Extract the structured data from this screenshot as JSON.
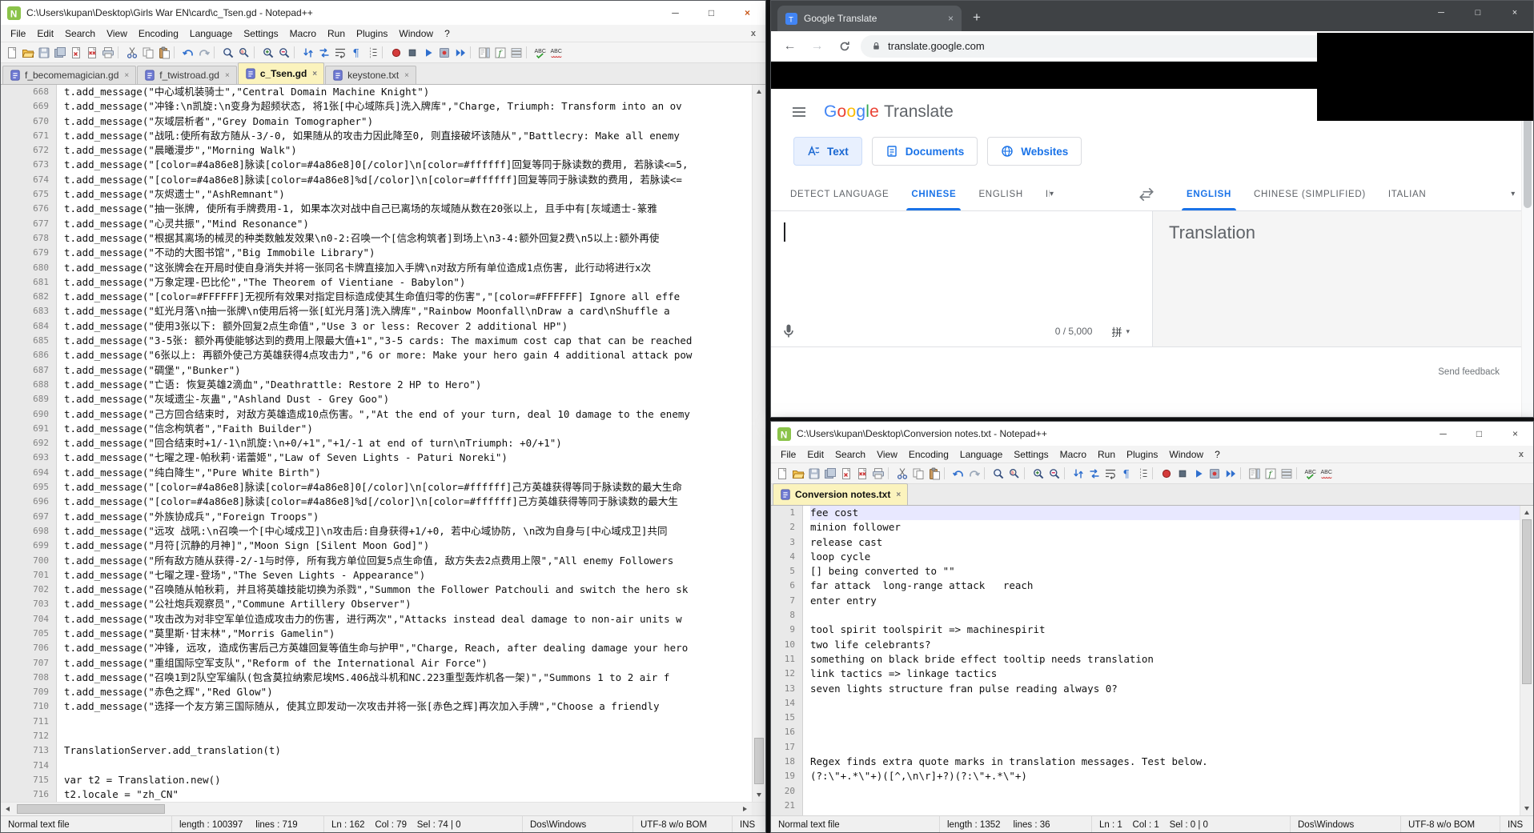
{
  "notepad_shared": {
    "menus": [
      "File",
      "Edit",
      "Search",
      "View",
      "Encoding",
      "Language",
      "Settings",
      "Macro",
      "Run",
      "Plugins",
      "Window",
      "?"
    ],
    "toolbar_icons": [
      "new-file",
      "open",
      "save",
      "save-all",
      "close",
      "close-all",
      "print",
      "sep",
      "cut",
      "copy",
      "paste",
      "sep",
      "undo",
      "redo",
      "sep",
      "find",
      "replace",
      "sep",
      "zoom-in",
      "zoom-out",
      "sep",
      "sync-v",
      "sync-h",
      "word-wrap",
      "show-all-chars",
      "indent-guide",
      "sep",
      "record-macro",
      "stop-macro",
      "play-macro",
      "save-macro",
      "run-macro",
      "sep",
      "doc-map",
      "function-list",
      "doc-list",
      "sep",
      "spell-check",
      "auto-spell"
    ]
  },
  "left_editor_window": {
    "title": "C:\\Users\\kupan\\Desktop\\Girls War EN\\card\\c_Tsen.gd - Notepad++",
    "tabs": [
      {
        "label": "f_becomemagician.gd",
        "active": false
      },
      {
        "label": "f_twistroad.gd",
        "active": false
      },
      {
        "label": "c_Tsen.gd",
        "active": true
      },
      {
        "label": "keystone.txt",
        "active": false
      }
    ],
    "first_line": 668,
    "current_line": 0,
    "lines": [
      "t.add_message(\"中心域机装骑士\",\"Central Domain Machine Knight\")",
      "t.add_message(\"冲锋:\\n凯旋:\\n变身为超频状态, 将1张[中心域陈兵]洗入牌库\",\"Charge, Triumph: Transform into an ov",
      "t.add_message(\"灰域层析者\",\"Grey Domain Tomographer\")",
      "t.add_message(\"战吼:使所有敌方随从-3/-0, 如果随从的攻击力因此降至0, 则直接破坏该随从\",\"Battlecry: Make all enemy",
      "t.add_message(\"晨曦漫步\",\"Morning Walk\")",
      "t.add_message(\"[color=#4a86e8]脉读[color=#4a86e8]0[/color]\\n[color=#ffffff]回复等同于脉读数的费用, 若脉读<=5,",
      "t.add_message(\"[color=#4a86e8]脉读[color=#4a86e8]%d[/color]\\n[color=#ffffff]回复等同于脉读数的费用, 若脉读<=",
      "t.add_message(\"灰烬遗士\",\"AshRemnant\")",
      "t.add_message(\"抽一张牌, 使所有手牌费用-1, 如果本次对战中自己已离场的灰域随从数在20张以上, 且手中有[灰域遗士-篆雅",
      "t.add_message(\"心灵共振\",\"Mind Resonance\")",
      "t.add_message(\"根据其离场的械灵的种类数触发效果\\n0-2:召唤一个[信念枸筑者]到场上\\n3-4:额外回复2费\\n5以上:额外再使",
      "t.add_message(\"不动的大图书馆\",\"Big Immobile Library\")",
      "t.add_message(\"这张牌会在开局时使自身消失并将一张同名卡牌直接加入手牌\\n对敌方所有单位造成1点伤害, 此行动将进行x次",
      "t.add_message(\"万象定理-巴比伦\",\"The Theorem of Vientiane - Babylon\")",
      "t.add_message(\"[color=#FFFFFF]无视所有效果对指定目标造成使其生命值归零的伤害\",\"[color=#FFFFFF] Ignore all effe",
      "t.add_message(\"虹光月落\\n抽一张牌\\n使用后将一张[虹光月落]洗入牌库\",\"Rainbow Moonfall\\nDraw a card\\nShuffle a",
      "t.add_message(\"使用3张以下: 额外回复2点生命值\",\"Use 3 or less: Recover 2 additional HP\")",
      "t.add_message(\"3-5张: 额外再使能够达到的费用上限最大值+1\",\"3-5 cards: The maximum cost cap that can be reached",
      "t.add_message(\"6张以上: 再额外使己方英雄获得4点攻击力\",\"6 or more: Make your hero gain 4 additional attack pow",
      "t.add_message(\"碉堡\",\"Bunker\")",
      "t.add_message(\"亡语: 恢复英雄2滴血\",\"Deathrattle: Restore 2 HP to Hero\")",
      "t.add_message(\"灰域遗尘-灰蛊\",\"Ashland Dust - Grey Goo\")",
      "t.add_message(\"己方回合结束时, 对敌方英雄造成10点伤害。\",\"At the end of your turn, deal 10 damage to the enemy",
      "t.add_message(\"信念枸筑者\",\"Faith Builder\")",
      "t.add_message(\"回合结束时+1/-1\\n凯旋:\\n+0/+1\",\"+1/-1 at end of turn\\nTriumph: +0/+1\")",
      "t.add_message(\"七曜之理-帕秋莉·诺蕾姬\",\"Law of Seven Lights - Paturi Noreki\")",
      "t.add_message(\"纯白降生\",\"Pure White Birth\")",
      "t.add_message(\"[color=#4a86e8]脉读[color=#4a86e8]0[/color]\\n[color=#ffffff]己方英雄获得等同于脉读数的最大生命",
      "t.add_message(\"[color=#4a86e8]脉读[color=#4a86e8]%d[/color]\\n[color=#ffffff]己方英雄获得等同于脉读数的最大生",
      "t.add_message(\"外族协成兵\",\"Foreign Troops\")",
      "t.add_message(\"远攻 战吼:\\n召唤一个[中心域戍卫]\\n攻击后:自身获得+1/+0, 若中心域协防, \\n改为自身与[中心域戍卫]共同",
      "t.add_message(\"月符[沉静的月神]\",\"Moon Sign [Silent Moon God]\")",
      "t.add_message(\"所有敌方随从获得-2/-1与时停, 所有我方单位回复5点生命值, 敌方失去2点费用上限\",\"All enemy Followers",
      "t.add_message(\"七曜之理-登场\",\"The Seven Lights - Appearance\")",
      "t.add_message(\"召唤随从帕秋莉, 并且将英雄技能切换为杀戮\",\"Summon the Follower Patchouli and switch the hero sk",
      "t.add_message(\"公社炮兵观察员\",\"Commune Artillery Observer\")",
      "t.add_message(\"攻击改为对非空军单位造成攻击力的伤害, 进行两次\",\"Attacks instead deal damage to non-air units w",
      "t.add_message(\"莫里斯·甘末林\",\"Morris Gamelin\")",
      "t.add_message(\"冲锋, 远攻, 造成伤害后己方英雄回复等值生命与护甲\",\"Charge, Reach, after dealing damage your hero",
      "t.add_message(\"重组国际空军支队\",\"Reform of the International Air Force\")",
      "t.add_message(\"召唤1到2队空军编队(包含莫拉纳索尼埃MS.406战斗机和NC.223重型轰炸机各一架)\",\"Summons 1 to 2 air f",
      "t.add_message(\"赤色之辉\",\"Red Glow\")",
      "t.add_message(\"选择一个友方第三国际随从, 使其立即发动一次攻击并将一张[赤色之辉]再次加入手牌\",\"Choose a friendly",
      "",
      "",
      "TranslationServer.add_translation(t)",
      "",
      "var t2 = Translation.new()",
      "t2.locale = \"zh_CN\""
    ],
    "status": {
      "doc_type": "Normal text file",
      "length_info": "length : 100397     lines : 719",
      "cursor_info": "Ln : 162    Col : 79    Sel : 74 | 0",
      "eol": "Dos\\Windows",
      "encoding": "UTF-8 w/o BOM",
      "ins": "INS"
    }
  },
  "browser_window": {
    "tab_title": "Google Translate",
    "url": "translate.google.com",
    "translate": {
      "logo_first": "Google",
      "logo_second": "Translate",
      "mode_buttons": [
        {
          "label": "Text",
          "icon": "translate-text",
          "active": true
        },
        {
          "label": "Documents",
          "icon": "document",
          "active": false
        },
        {
          "label": "Websites",
          "icon": "globe",
          "active": false
        }
      ],
      "source_languages": [
        {
          "label": "DETECT LANGUAGE",
          "active": false
        },
        {
          "label": "CHINESE",
          "active": true
        },
        {
          "label": "ENGLISH",
          "active": false
        },
        {
          "label": "IRISH",
          "active": false
        }
      ],
      "target_languages": [
        {
          "label": "ENGLISH",
          "active": true
        },
        {
          "label": "CHINESE (SIMPLIFIED)",
          "active": false
        },
        {
          "label": "ITALIAN",
          "active": false
        }
      ],
      "char_counter": "0 / 5,000",
      "ime_label": "拼",
      "output_placeholder": "Translation",
      "feedback_label": "Send feedback"
    }
  },
  "notes_window": {
    "title": "C:\\Users\\kupan\\Desktop\\Conversion notes.txt - Notepad++",
    "tabs": [
      {
        "label": "Conversion notes.txt",
        "active": true
      }
    ],
    "first_line": 1,
    "current_line": 1,
    "lines": [
      "fee cost",
      "minion follower",
      "release cast",
      "loop cycle",
      "[] being converted to \"\"",
      "far attack  long-range attack   reach",
      "enter entry",
      "",
      "tool spirit toolspirit => machinespirit",
      "two life celebrants?",
      "something on black bride effect tooltip needs translation",
      "link tactics => linkage tactics",
      "seven lights structure fran pulse reading always 0?",
      "",
      "",
      "",
      "",
      "Regex finds extra quote marks in translation messages. Test below.",
      "(?:\\\"+.*\\\"+)([^,\\n\\r]+?)(?:\\\"+.*\\\"+)",
      "",
      ""
    ],
    "status": {
      "doc_type": "Normal text file",
      "length_info": "length : 1352     lines : 36",
      "cursor_info": "Ln : 1    Col : 1    Sel : 0 | 0",
      "eol": "Dos\\Windows",
      "encoding": "UTF-8 w/o BOM",
      "ins": "INS"
    }
  }
}
